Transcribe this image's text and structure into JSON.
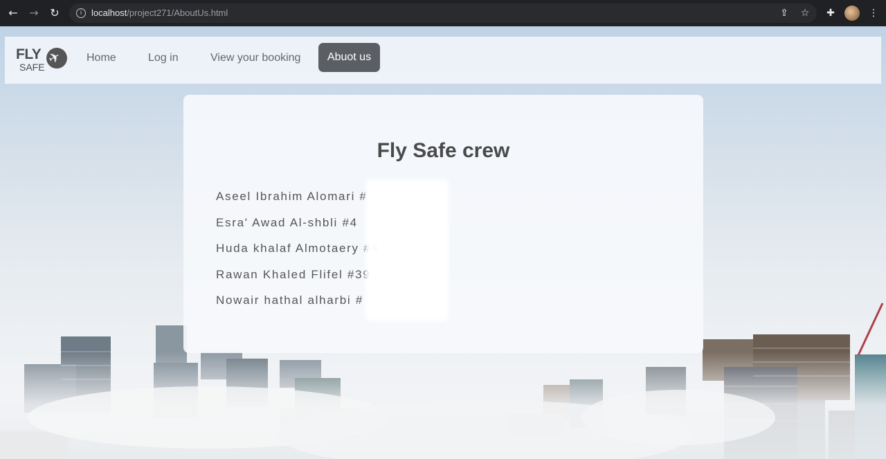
{
  "browser": {
    "url_host": "localhost",
    "url_path": "/project271/AboutUs.html",
    "icons": [
      "back-arrow-icon",
      "forward-arrow-icon",
      "reload-icon",
      "info-icon",
      "share-icon",
      "star-icon",
      "extensions-icon",
      "menu-icon"
    ]
  },
  "navbar": {
    "logo_top": "FLY",
    "logo_bottom": "SAFE",
    "links": [
      "Home",
      "Log in",
      "View your booking"
    ],
    "active_link": "Abuot us"
  },
  "card": {
    "title": "Fly Safe crew",
    "members": [
      "Aseel Ibrahim Alomari #",
      "Esra' Awad Al-shbli #4",
      "Huda khalaf Almotaery #4",
      "Rawan Khaled Flifel #39",
      "Nowair hathal alharbi #"
    ]
  },
  "colors": {
    "active_tab": "#5b5e63",
    "text": "#555555",
    "browser_bar": "#202124"
  }
}
